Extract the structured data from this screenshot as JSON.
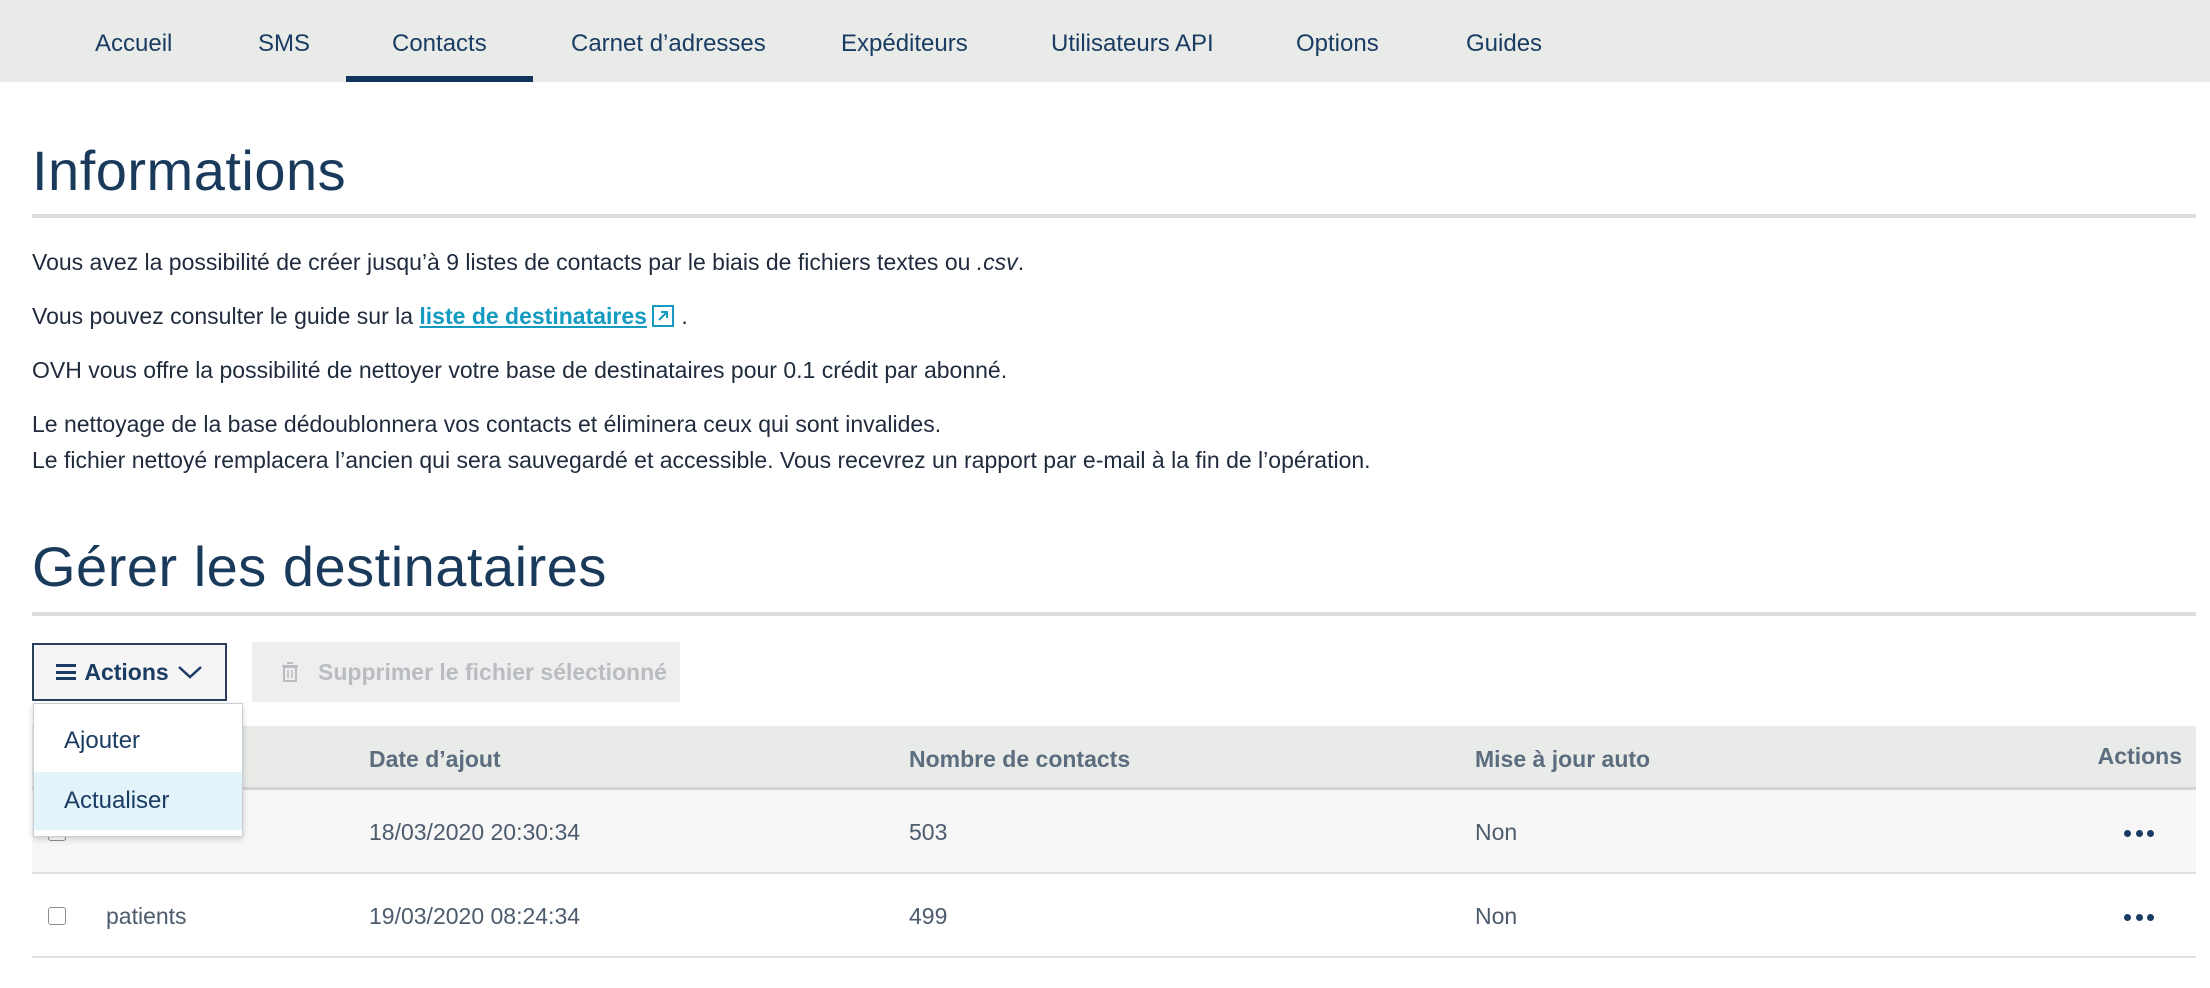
{
  "nav": {
    "tabs": [
      {
        "label": "Accueil"
      },
      {
        "label": "SMS"
      },
      {
        "label": "Contacts",
        "active": true
      },
      {
        "label": "Carnet d’adresses"
      },
      {
        "label": "Expéditeurs"
      },
      {
        "label": "Utilisateurs API"
      },
      {
        "label": "Options"
      },
      {
        "label": "Guides"
      }
    ]
  },
  "info": {
    "title": "Informations",
    "line1_pre": "Vous avez la possibilité de créer jusqu’à 9 listes de contacts par le biais de fichiers textes ou ",
    "line1_em": ".csv",
    "line1_post": ".",
    "line2_pre": "Vous pouvez consulter le guide sur la ",
    "line2_link": "liste de destinataires",
    "line2_post": " .",
    "line3": "OVH vous offre la possibilité de nettoyer votre base de destinataires pour 0.1 crédit par abonné.",
    "line4": "Le nettoyage de la base dédoublonnera vos contacts et éliminera ceux qui sont invalides.",
    "line5": "Le fichier nettoyé remplacera l’ancien qui sera sauvegardé et accessible. Vous recevrez un rapport par e-mail à la fin de l’opération."
  },
  "manage": {
    "title": "Gérer les destinataires",
    "actions_label": "Actions",
    "delete_label": "Supprimer le fichier sélectionné",
    "menu": [
      "Ajouter",
      "Actualiser"
    ]
  },
  "table": {
    "headers": [
      "Date d’ajout",
      "Nombre de contacts",
      "Mise à jour auto",
      "Actions"
    ],
    "rows": [
      {
        "name": "",
        "date": "18/03/2020 20:30:34",
        "count": "503",
        "auto": "Non"
      },
      {
        "name": "patients",
        "date": "19/03/2020 08:24:34",
        "count": "499",
        "auto": "Non"
      }
    ]
  },
  "colors": {
    "nav_bg": "#e9ebe8",
    "active_tab": "#12335c",
    "link": "#149bbf",
    "menu_highlight": "#e3f3fa"
  }
}
